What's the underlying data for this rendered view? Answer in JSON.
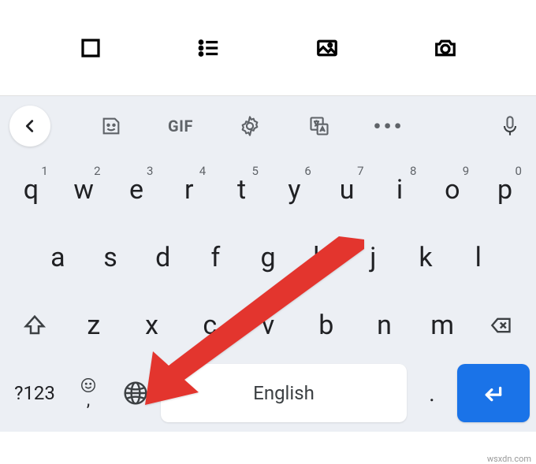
{
  "app_toolbar": {
    "buttons": [
      "square-icon",
      "list-icon",
      "image-icon",
      "camera-icon"
    ]
  },
  "suggest_row": {
    "back": "<",
    "gif": "GIF",
    "more": "•••"
  },
  "rows": {
    "r1": [
      {
        "k": "q",
        "a": "1"
      },
      {
        "k": "w",
        "a": "2"
      },
      {
        "k": "e",
        "a": "3"
      },
      {
        "k": "r",
        "a": "4"
      },
      {
        "k": "t",
        "a": "5"
      },
      {
        "k": "y",
        "a": "6"
      },
      {
        "k": "u",
        "a": "7"
      },
      {
        "k": "i",
        "a": "8"
      },
      {
        "k": "o",
        "a": "9"
      },
      {
        "k": "p",
        "a": "0"
      }
    ],
    "r2": [
      "a",
      "s",
      "d",
      "f",
      "g",
      "h",
      "j",
      "k",
      "l"
    ],
    "r3": [
      "z",
      "x",
      "c",
      "v",
      "b",
      "n",
      "m"
    ]
  },
  "bottom": {
    "sym": "?123",
    "comma": ",",
    "space": "English",
    "dot": "."
  },
  "watermark": "wsxdn.com"
}
